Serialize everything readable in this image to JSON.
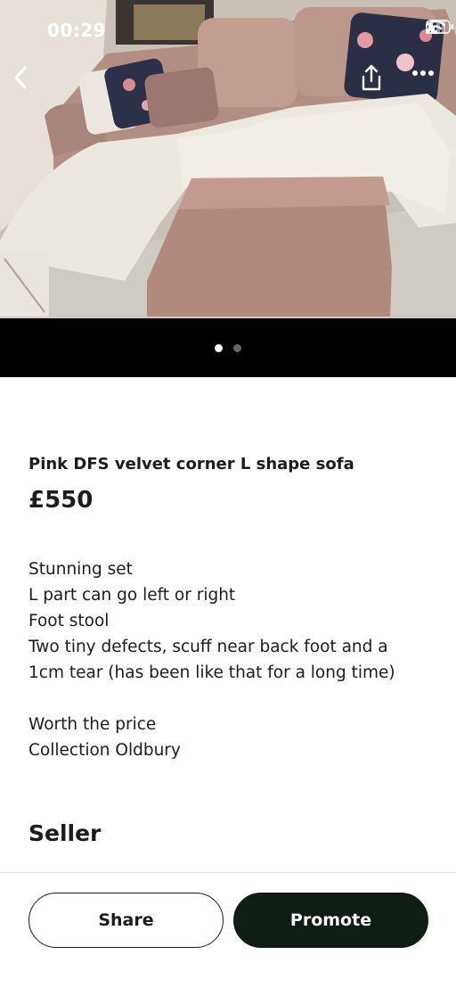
{
  "status_bar": {
    "time": "00:29"
  },
  "gallery": {
    "image_alt": "Photo of pink velvet corner sofa with footstool",
    "total_images": 2,
    "active_index": 0
  },
  "listing": {
    "title": "Pink DFS velvet corner L shape sofa",
    "price": "£550",
    "description_lines": [
      "Stunning set",
      "L part can go left or right",
      "Foot stool",
      "Two tiny defects, scuff near back foot and a",
      "1cm tear (has been like that for a long time)",
      "",
      "Worth the price",
      "Collection Oldbury"
    ]
  },
  "seller": {
    "heading": "Seller"
  },
  "actions": {
    "share_label": "Share",
    "promote_label": "Promote"
  },
  "icons": {
    "back": "chevron-left-icon",
    "share": "share-upload-icon",
    "more": "more-horizontal-icon",
    "signal": "signal-icon",
    "wifi": "wifi-icon",
    "battery": "battery-icon"
  },
  "colors": {
    "primary_button": "#0f1d14",
    "text": "#1a1d1a",
    "gallery_bar": "#000000"
  }
}
